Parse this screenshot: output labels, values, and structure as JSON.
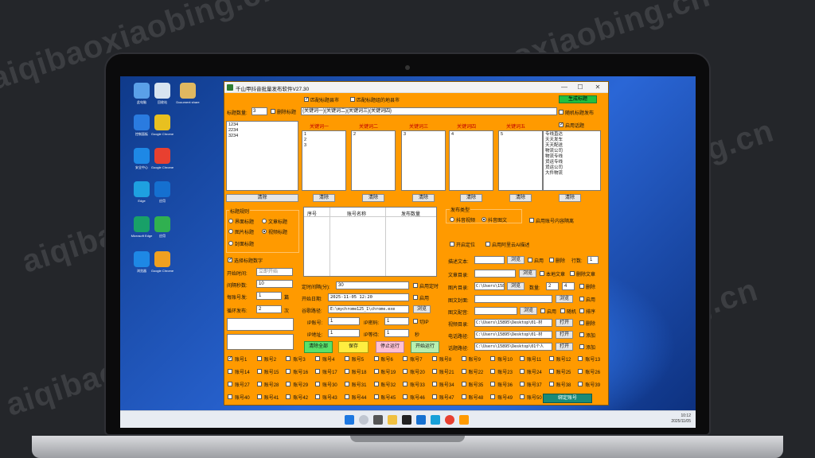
{
  "watermark": "aiqibaoxiaobing.cn",
  "desktop": {
    "icons": [
      {
        "label": "此电脑",
        "color": "#5aa0e8"
      },
      {
        "label": "回收站",
        "color": "#d8e4f0"
      },
      {
        "label": "Document share",
        "color": "#e0b860"
      },
      {
        "label": "控制面板",
        "color": "#2a7be0"
      },
      {
        "label": "Google Chrome",
        "color": "#e8c020"
      },
      {
        "label": "安全中心",
        "color": "#1e88e5"
      },
      {
        "label": "Google Chrome",
        "color": "#e84030"
      },
      {
        "label": "Edge",
        "color": "#1ea0e0"
      },
      {
        "label": "应用",
        "color": "#1570d0"
      },
      {
        "label": "Microsoft Edge",
        "color": "#18a068"
      },
      {
        "label": "应用",
        "color": "#30b050"
      },
      {
        "label": "浏览器",
        "color": "#1e88e5"
      },
      {
        "label": "Google Chrome",
        "color": "#f0a020"
      }
    ],
    "clock_time": "10:12",
    "clock_date": "2025/11/05"
  },
  "app": {
    "title": "千山甲抖音批量发布软件V27.30",
    "close_glyph": "✕",
    "min_glyph": "—",
    "max_glyph": "☐",
    "top": {
      "match_title_label": "匹配标题县市",
      "match_title_checked": true,
      "match_local_label": "匹配标题组的地县市",
      "match_local_checked": false,
      "generate_btn": "生成标题",
      "title_count_label": "标题数量:",
      "title_count_value": "3",
      "delete_title_label": "删除标题",
      "keyword_template": "{关键词一}{关键词二}{关键词三}{关键词四}",
      "random_publish_label": "随机标题发布"
    },
    "title_list": "1234\n2234\n3234",
    "keyword_headers": [
      "关键词一",
      "关键词二",
      "关键词三",
      "关键词四",
      "关键词五"
    ],
    "keyword_lists": [
      "1\n2\n3",
      "2",
      "3",
      "4",
      "5"
    ],
    "enable_topic_label": "启用话题",
    "enable_topic_checked": true,
    "topic_list": "专线直达\n天天发车\n天天配送\n物流公司\n物流专线\n货运专线\n货运公司\n大件物流",
    "clear_label": "清除",
    "rules": {
      "header": "标题规则",
      "options": [
        "界面标题",
        "文章标题",
        "图片标题",
        "视频标题",
        "封面标题"
      ],
      "selected": "视频标题"
    },
    "select_title_label": "选择标题数字",
    "start_time_label": "开始时间:",
    "start_time_value": "立即开始",
    "interval_label": "间隔秒数:",
    "interval_value": "10",
    "per_account_label": "每账号发:",
    "per_account_value": "1",
    "per_account_unit": "篇",
    "loop_label": "循环发布:",
    "loop_value": "2",
    "loop_unit": "次",
    "table_headers": [
      "序号",
      "账号名称",
      "发布数量"
    ],
    "publish_type": {
      "header": "发布类型",
      "options": [
        "抖音视频",
        "抖音图文"
      ],
      "selected": "抖音图文"
    },
    "enable_account_separation": "启用账号内容隔离",
    "enable_location": "开启定位",
    "enable_ali_ai": "启用阿里云Ai描述",
    "timer_label": "定时间隔(分):",
    "timer_value": "30",
    "enable_timer": "启用定时",
    "start_date_label": "开始日期:",
    "start_date_value": "2025-11-05 12:20",
    "enable_label": "启用",
    "chrome_label": "谷歌路径:",
    "chrome_value": "E:\\mychrome125_1\\chrome.exe",
    "browse": "浏览",
    "ip_account_label": "IP账号:",
    "ip_account_value": "1",
    "ip_password_label": "IP密码:",
    "ip_password_value": "1",
    "switch_ip_label": "切IP",
    "ip_address_label": "IP地址:",
    "ip_address_value": "1",
    "ip_wait_label": "IP等待:",
    "ip_wait_value": "1",
    "ip_wait_unit": "秒",
    "buttons": {
      "clear_all": "清除全部",
      "save": "保存",
      "stop": "停止运行",
      "start": "开始运行",
      "bind": "绑定账号"
    },
    "desc_text_label": "描述文本:",
    "delete_label": "删除",
    "rows_label": "行数:",
    "rows_value": "1",
    "article_dir_label": "文章目录:",
    "local_article_label": "本地文章",
    "delete_article_label": "删除文章",
    "image_dir_label": "图片目录:",
    "image_dir_value": "C:\\Users\\15895",
    "count_label": "数量:",
    "count_a": "2",
    "count_b": "4",
    "image_cover_label": "图文封面:",
    "image_music_label": "图文配音:",
    "random_label": "随机",
    "sort_label": "排序",
    "video_dir_label": "视频目录:",
    "video_dir_value": "C:\\Users\\15895\\Desktop\\01-材",
    "open_label": "打开",
    "phone_path_label": "电话路径:",
    "phone_path_value": "C:\\Users\\15895\\Desktop\\01-材",
    "add_label": "添加",
    "topic_path_label": "话题路径:",
    "topic_path_value": "C:\\Users\\15895\\Desktop\\01个人",
    "accounts": [
      "账号1",
      "账号2",
      "账号3",
      "账号4",
      "账号5",
      "账号6",
      "账号7",
      "账号8",
      "账号9",
      "账号10",
      "账号11",
      "账号12",
      "账号13",
      "账号14",
      "账号15",
      "账号16",
      "账号17",
      "账号18",
      "账号19",
      "账号20",
      "账号21",
      "账号22",
      "账号23",
      "账号24",
      "账号25",
      "账号26",
      "账号27",
      "账号28",
      "账号29",
      "账号30",
      "账号31",
      "账号32",
      "账号33",
      "账号34",
      "账号35",
      "账号36",
      "账号37",
      "账号38",
      "账号39",
      "账号40",
      "账号41",
      "账号42",
      "账号43",
      "账号44",
      "账号45",
      "账号46",
      "账号47",
      "账号48",
      "账号49",
      "账号50"
    ],
    "account1_checked": true
  }
}
